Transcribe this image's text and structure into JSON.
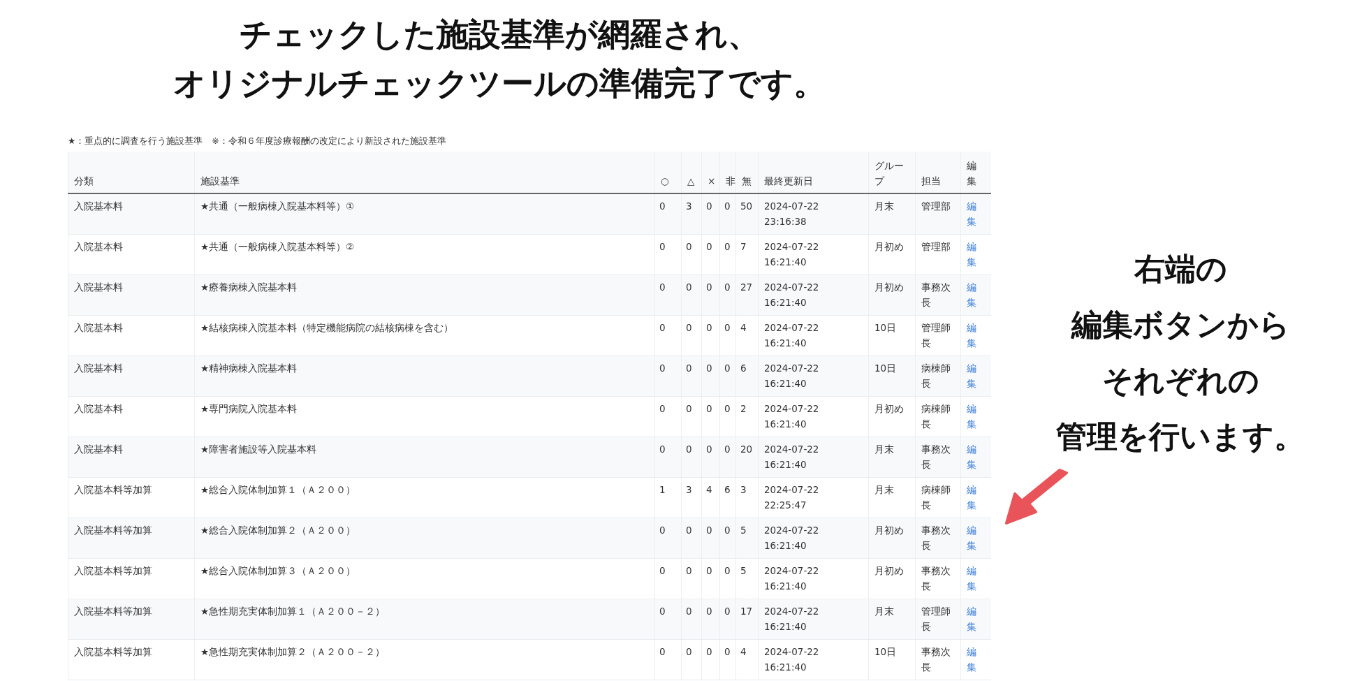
{
  "headline": [
    "チェックした施設基準が網羅され、",
    "オリジナルチェックツールの準備完了です。"
  ],
  "legend": "★：重点的に調査を行う施設基準　※：令和６年度診療報酬の改定により新設された施設基準",
  "table": {
    "columns": [
      "分類",
      "施設基準",
      "○",
      "△",
      "×",
      "非",
      "無",
      "最終更新日",
      "グループ",
      "担当",
      "編集"
    ],
    "rows": [
      {
        "category": "入院基本料",
        "standard": "★共通（一般病棟入院基本料等）①",
        "c1": "0",
        "c2": "3",
        "c3": "0",
        "c4": "0",
        "c5": "50",
        "updated": "2024-07-22 23:16:38",
        "group": "月末",
        "owner": "管理部",
        "edit": "編集"
      },
      {
        "category": "入院基本料",
        "standard": "★共通（一般病棟入院基本料等）②",
        "c1": "0",
        "c2": "0",
        "c3": "0",
        "c4": "0",
        "c5": "7",
        "updated": "2024-07-22 16:21:40",
        "group": "月初め",
        "owner": "管理部",
        "edit": "編集"
      },
      {
        "category": "入院基本料",
        "standard": "★療養病棟入院基本料",
        "c1": "0",
        "c2": "0",
        "c3": "0",
        "c4": "0",
        "c5": "27",
        "updated": "2024-07-22 16:21:40",
        "group": "月初め",
        "owner": "事務次長",
        "edit": "編集"
      },
      {
        "category": "入院基本料",
        "standard": "★結核病棟入院基本料（特定機能病院の結核病棟を含む）",
        "c1": "0",
        "c2": "0",
        "c3": "0",
        "c4": "0",
        "c5": "4",
        "updated": "2024-07-22 16:21:40",
        "group": "10日",
        "owner": "管理師長",
        "edit": "編集"
      },
      {
        "category": "入院基本料",
        "standard": "★精神病棟入院基本料",
        "c1": "0",
        "c2": "0",
        "c3": "0",
        "c4": "0",
        "c5": "6",
        "updated": "2024-07-22 16:21:40",
        "group": "10日",
        "owner": "病棟師長",
        "edit": "編集"
      },
      {
        "category": "入院基本料",
        "standard": "★専門病院入院基本料",
        "c1": "0",
        "c2": "0",
        "c3": "0",
        "c4": "0",
        "c5": "2",
        "updated": "2024-07-22 16:21:40",
        "group": "月初め",
        "owner": "病棟師長",
        "edit": "編集"
      },
      {
        "category": "入院基本料",
        "standard": "★障害者施設等入院基本料",
        "c1": "0",
        "c2": "0",
        "c3": "0",
        "c4": "0",
        "c5": "20",
        "updated": "2024-07-22 16:21:40",
        "group": "月末",
        "owner": "事務次長",
        "edit": "編集"
      },
      {
        "category": "入院基本料等加算",
        "standard": "★総合入院体制加算１（Ａ２００）",
        "c1": "1",
        "c2": "3",
        "c3": "4",
        "c4": "6",
        "c5": "3",
        "updated": "2024-07-22 22:25:47",
        "group": "月末",
        "owner": "病棟師長",
        "edit": "編集"
      },
      {
        "category": "入院基本料等加算",
        "standard": "★総合入院体制加算２（Ａ２００）",
        "c1": "0",
        "c2": "0",
        "c3": "0",
        "c4": "0",
        "c5": "5",
        "updated": "2024-07-22 16:21:40",
        "group": "月初め",
        "owner": "事務次長",
        "edit": "編集"
      },
      {
        "category": "入院基本料等加算",
        "standard": "★総合入院体制加算３（Ａ２００）",
        "c1": "0",
        "c2": "0",
        "c3": "0",
        "c4": "0",
        "c5": "5",
        "updated": "2024-07-22 16:21:40",
        "group": "月初め",
        "owner": "事務次長",
        "edit": "編集"
      },
      {
        "category": "入院基本料等加算",
        "standard": "★急性期充実体制加算１（Ａ２００－２）",
        "c1": "0",
        "c2": "0",
        "c3": "0",
        "c4": "0",
        "c5": "17",
        "updated": "2024-07-22 16:21:40",
        "group": "月末",
        "owner": "管理師長",
        "edit": "編集"
      },
      {
        "category": "入院基本料等加算",
        "standard": "★急性期充実体制加算２（Ａ２００－２）",
        "c1": "0",
        "c2": "0",
        "c3": "0",
        "c4": "0",
        "c5": "4",
        "updated": "2024-07-22 16:21:40",
        "group": "10日",
        "owner": "事務次長",
        "edit": "編集"
      }
    ]
  },
  "callout": [
    "右端の",
    "編集ボタンから",
    "それぞれの",
    "管理を行います。"
  ]
}
